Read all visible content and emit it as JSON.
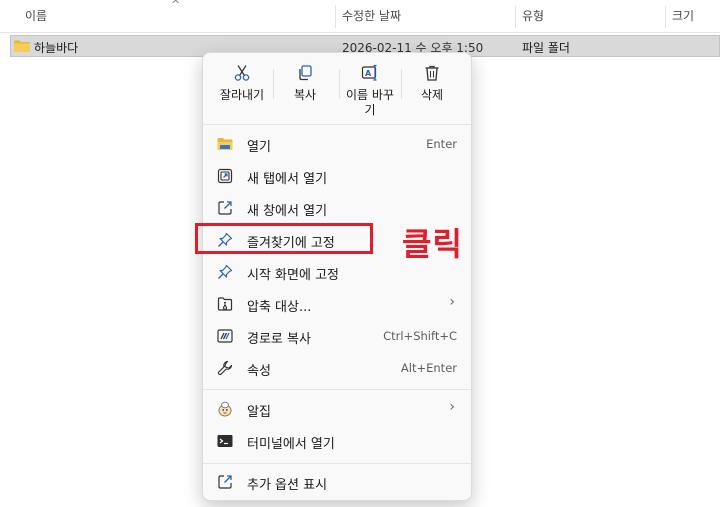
{
  "header": {
    "name": "이름",
    "date_modified": "수정한 날짜",
    "type": "유형",
    "size": "크기"
  },
  "file_row": {
    "name": "하늘바다",
    "date": "2026-02-11 수 오후 1:50",
    "type": "파일 폴더",
    "icon": "folder-icon"
  },
  "quick_actions": [
    {
      "label": "잘라내기",
      "icon": "scissors-icon"
    },
    {
      "label": "복사",
      "icon": "copy-icon"
    },
    {
      "label": "이름 바꾸기",
      "icon": "rename-icon"
    },
    {
      "label": "삭제",
      "icon": "trash-icon"
    }
  ],
  "menu": {
    "open": {
      "label": "열기",
      "shortcut": "Enter",
      "icon": "folder-open-icon"
    },
    "open_tab": {
      "label": "새 탭에서 열기",
      "icon": "new-tab-icon"
    },
    "open_window": {
      "label": "새 창에서 열기",
      "icon": "new-window-icon"
    },
    "pin_quick": {
      "label": "즐겨찾기에 고정",
      "icon": "pin-icon"
    },
    "pin_start": {
      "label": "시작 화면에 고정",
      "icon": "pin-icon"
    },
    "compress": {
      "label": "압축 대상...",
      "icon": "zip-icon"
    },
    "copy_path": {
      "label": "경로로 복사",
      "shortcut": "Ctrl+Shift+C",
      "icon": "copy-path-icon"
    },
    "properties": {
      "label": "속성",
      "shortcut": "Alt+Enter",
      "icon": "wrench-icon"
    },
    "alzip": {
      "label": "알집",
      "icon": "alzip-icon"
    },
    "terminal": {
      "label": "터미널에서 열기",
      "icon": "terminal-icon"
    },
    "more": {
      "label": "추가 옵션 표시",
      "icon": "more-options-icon"
    }
  },
  "annotation": {
    "text": "클릭",
    "color": "#e01e2b"
  }
}
